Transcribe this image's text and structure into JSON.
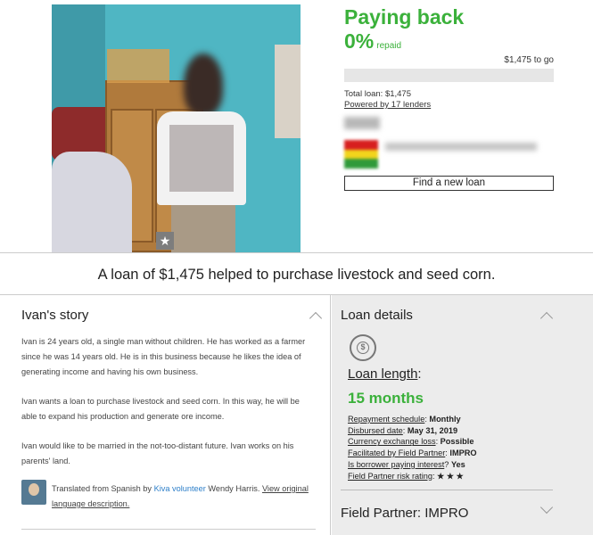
{
  "summary": {
    "status": "Paying back",
    "percent": "0%",
    "percent_label": "repaid",
    "to_go": "$1,475 to go",
    "progress": 0,
    "total_loan": "Total loan: $1,475",
    "powered_by": "Powered by 17 lenders",
    "find_button": "Find a new loan"
  },
  "headline": "A loan of $1,475 helped to purchase livestock and seed corn.",
  "story": {
    "title": "Ivan's story",
    "paragraphs": [
      "Ivan is 24 years old, a single man without children. He has worked as a farmer since he was 14 years old. He is in this business because he likes the idea of generating income and having his own business.",
      "Ivan wants a loan to purchase livestock and seed corn. In this way, he will be able to expand his production and generate ore income.",
      "Ivan would like to be married in the not-too-distant future. Ivan works on his parents' land."
    ],
    "translated_prefix": "Translated from Spanish by ",
    "volunteer_link": "Kiva volunteer",
    "translator": " Wendy Harris. ",
    "view_original": "View original language description."
  },
  "details": {
    "title": "Loan details",
    "loan_length_label": "Loan length",
    "loan_length_value": "15 months",
    "items": [
      {
        "key": "Repayment schedule",
        "value": "Monthly"
      },
      {
        "key": "Disbursed date",
        "value": "May 31, 2019"
      },
      {
        "key": "Currency exchange loss",
        "value": "Possible"
      },
      {
        "key": "Facilitated by Field Partner",
        "value": "IMPRO"
      },
      {
        "key": "Is borrower paying interest",
        "sep": "? ",
        "value": "Yes"
      },
      {
        "key": "Field Partner risk rating",
        "value": "★ ★ ★"
      }
    ],
    "field_partner": "Field Partner: IMPRO"
  },
  "colors": {
    "accent": "#3bb13b",
    "link": "#2d7fc9"
  },
  "icons": {
    "repayment": "currency-cycle-icon",
    "photo_badge": "star-icon"
  }
}
